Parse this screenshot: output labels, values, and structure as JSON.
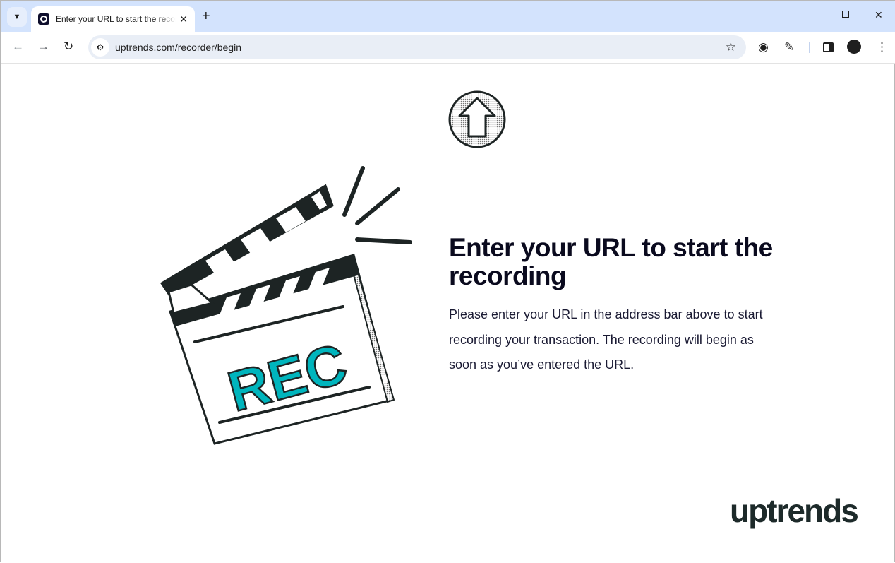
{
  "browser": {
    "tab_title": "Enter your URL to start the recording",
    "url": "uptrends.com/recorder/begin",
    "icons": [
      "tab-search-icon",
      "favicon-icon",
      "close-icon",
      "new-tab-icon",
      "minimize-icon",
      "maximize-icon",
      "close-window-icon",
      "back-icon",
      "forward-icon",
      "reload-icon",
      "site-info-icon",
      "bookmark-star-icon",
      "recorder-extension-icon",
      "extensions-icon",
      "side-panel-icon",
      "profile-icon",
      "menu-icon"
    ]
  },
  "page": {
    "heading": "Enter your URL to start the recording",
    "description": "Please enter your URL in the address bar above to start recording your transaction. The recording will begin as soon as you’ve entered the URL.",
    "illustration_text": "REC",
    "logo": "uptrends",
    "accent_color": "#00b5bd"
  }
}
